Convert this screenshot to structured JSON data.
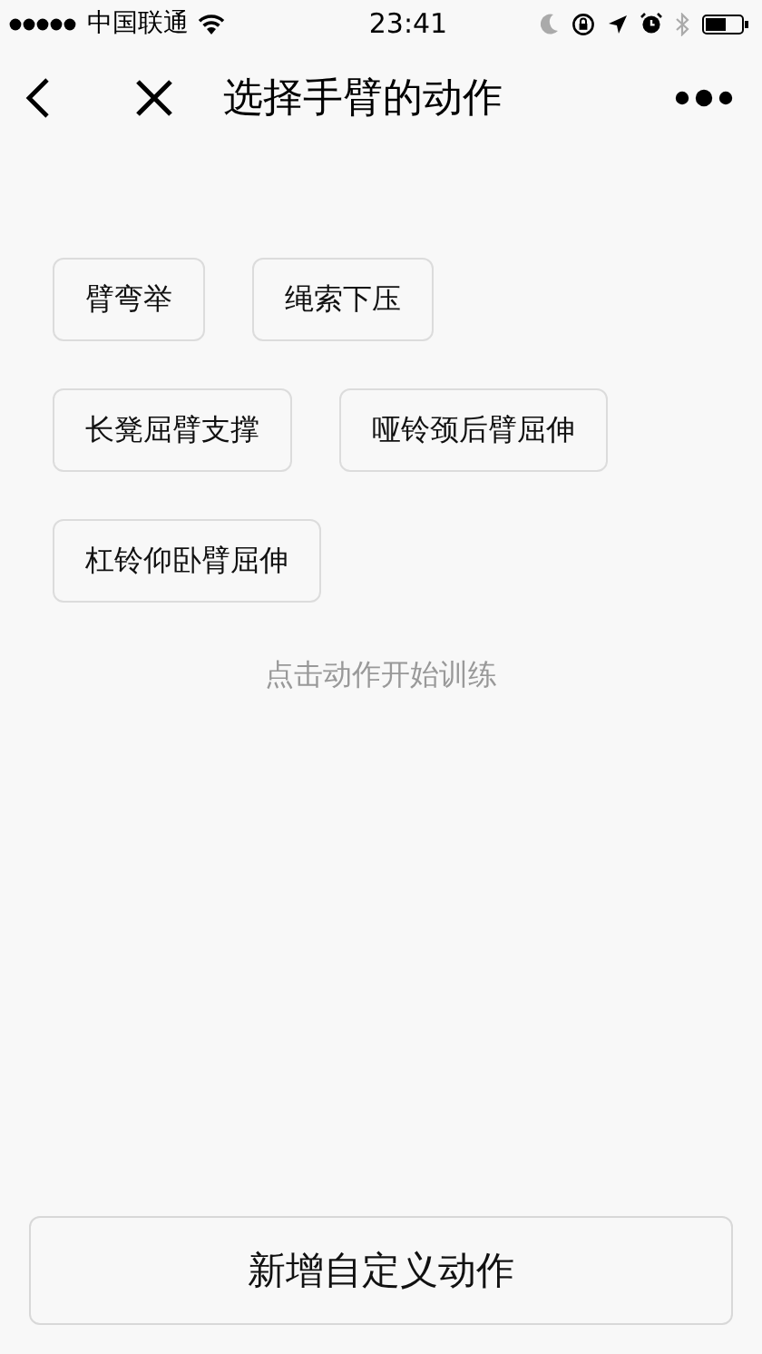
{
  "status_bar": {
    "carrier": "中国联通",
    "time": "23:41"
  },
  "nav_bar": {
    "title": "选择手臂的动作"
  },
  "exercises": [
    {
      "label": "臂弯举"
    },
    {
      "label": "绳索下压"
    },
    {
      "label": "长凳屈臂支撑"
    },
    {
      "label": "哑铃颈后臂屈伸"
    },
    {
      "label": "杠铃仰卧臂屈伸"
    }
  ],
  "hint": "点击动作开始训练",
  "add_button": {
    "label": "新增自定义动作"
  }
}
